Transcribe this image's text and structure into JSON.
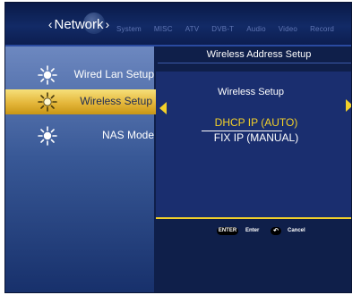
{
  "header": {
    "active_section": "Network",
    "tabs": [
      "System",
      "MISC",
      "ATV",
      "DVB-T",
      "Audio",
      "Video",
      "Record"
    ]
  },
  "sidebar": {
    "items": [
      {
        "label": "Wired Lan Setup",
        "icon": "sun-icon",
        "selected": false
      },
      {
        "label": "Wireless Setup",
        "icon": "sun-icon",
        "selected": true
      },
      {
        "label": "NAS Mode",
        "icon": "sun-icon",
        "selected": false
      }
    ]
  },
  "panel": {
    "title": "Wireless Address Setup",
    "sub_heading": "Wireless Setup",
    "options": [
      "DHCP IP (AUTO)",
      "FIX IP (MANUAL)"
    ],
    "selected_option": 0
  },
  "footer": {
    "enter_key": "ENTER",
    "enter_label": "Enter",
    "cancel_key": "↶",
    "cancel_label": "Cancel"
  },
  "colors": {
    "accent": "#f2d02a",
    "background": "#0f1f4a",
    "selected_bar": "#e4b63a"
  }
}
